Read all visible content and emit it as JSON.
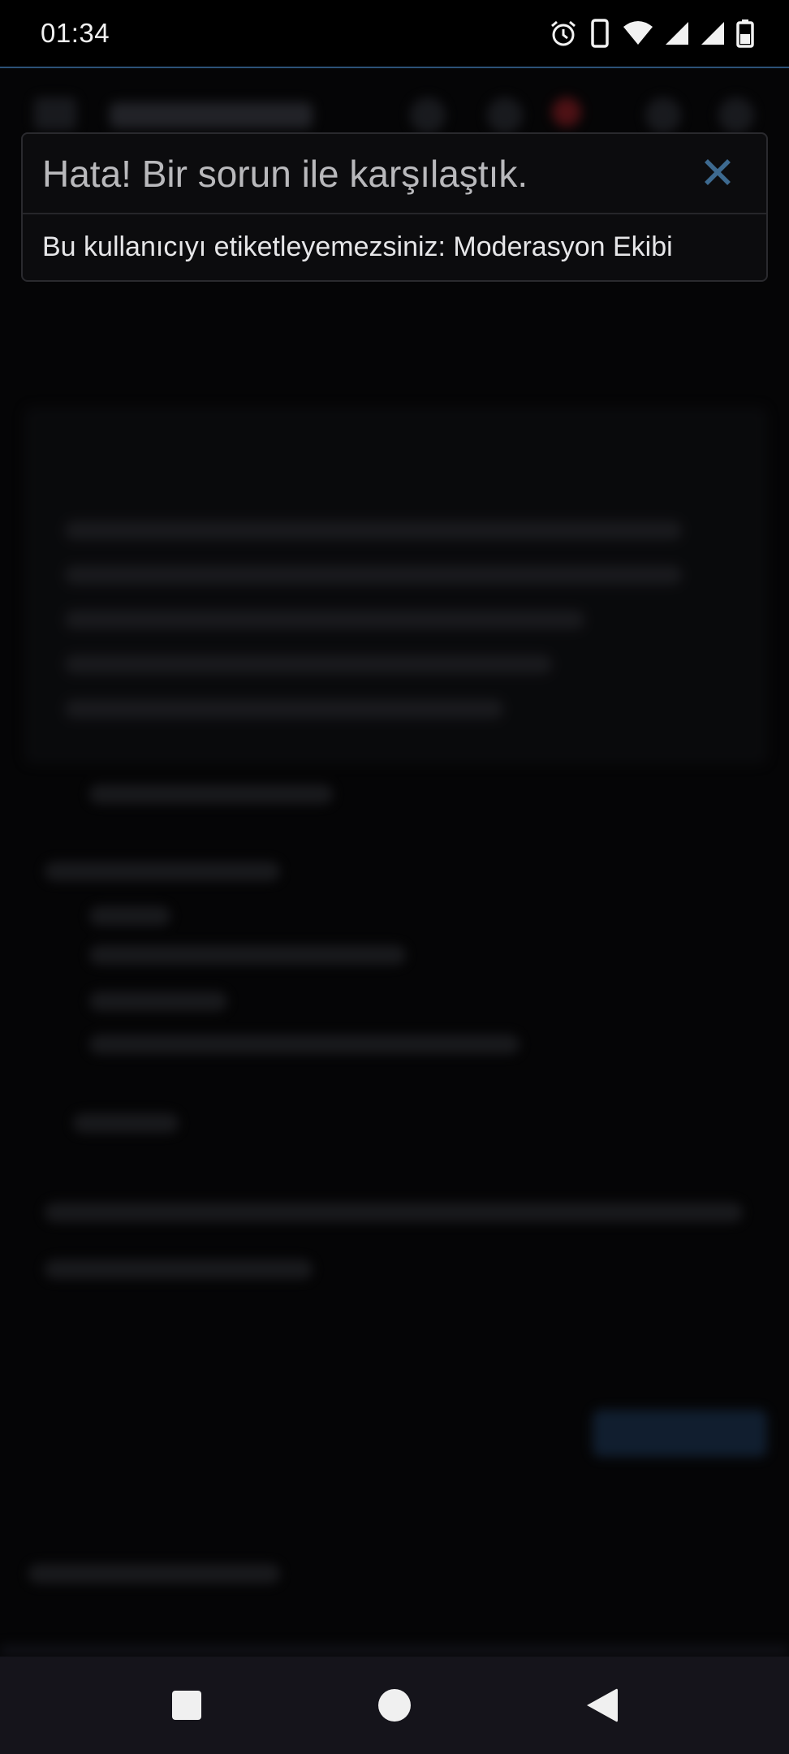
{
  "status_bar": {
    "time": "01:34",
    "icons": [
      "alarm-icon",
      "phone-icon",
      "wifi-icon",
      "signal-icon",
      "signal-icon",
      "battery-icon"
    ]
  },
  "dialog": {
    "title": "Hata! Bir sorun ile karşılaştık.",
    "message": "Bu kullanıcıyı etiketleyemezsiniz: Moderasyon Ekibi",
    "close_icon": "close-icon"
  },
  "nav_bar": {
    "buttons": [
      "recents-square-icon",
      "home-circle-icon",
      "back-triangle-icon"
    ]
  },
  "colors": {
    "accent_line": "#2b5177",
    "close_icon": "#3d6a90",
    "dialog_bg": "#0c0c0e",
    "navbar_bg": "#15141b"
  }
}
